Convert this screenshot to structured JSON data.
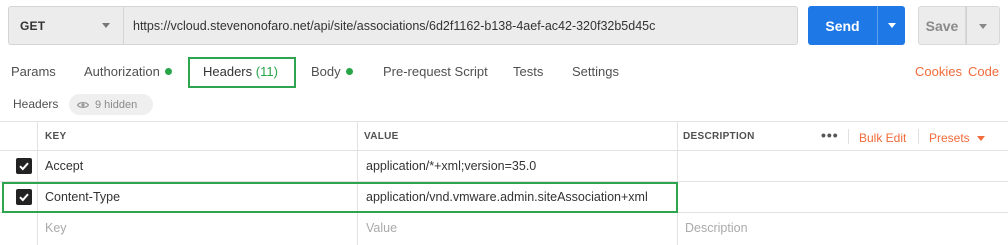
{
  "request": {
    "method": "GET",
    "url": "https://vcloud.stevenonofaro.net/api/site/associations/6d2f1162-b138-4aef-ac42-320f32b5d45c",
    "send_label": "Send",
    "save_label": "Save"
  },
  "tabs": [
    {
      "label": "Params",
      "dot": false
    },
    {
      "label": "Authorization",
      "dot": true
    },
    {
      "label": "Headers",
      "count": "(11)",
      "active": true
    },
    {
      "label": "Body",
      "dot": true
    },
    {
      "label": "Pre-request Script"
    },
    {
      "label": "Tests"
    },
    {
      "label": "Settings"
    }
  ],
  "right_links": {
    "cookies": "Cookies",
    "code": "Code"
  },
  "headers_section": {
    "title": "Headers",
    "hidden_label": "9 hidden"
  },
  "table": {
    "columns": {
      "key": "KEY",
      "value": "VALUE",
      "description": "DESCRIPTION"
    },
    "actions": {
      "more": "•••",
      "bulk_edit": "Bulk Edit",
      "presets": "Presets"
    },
    "rows": [
      {
        "key": "Accept",
        "value": "application/*+xml;version=35.0",
        "checked": true
      },
      {
        "key": "Content-Type",
        "value": "application/vnd.vmware.admin.siteAssociation+xml",
        "checked": true
      }
    ],
    "placeholder": {
      "key": "Key",
      "value": "Value",
      "description": "Description"
    }
  },
  "colors": {
    "accent": "#f26b3a",
    "send": "#1e78e6",
    "status_dot": "#27a548",
    "highlight": "#2ea44f"
  },
  "icons": [
    "chevron-down-icon",
    "eye-icon",
    "checkbox-checked-icon",
    "more-dots-icon"
  ]
}
